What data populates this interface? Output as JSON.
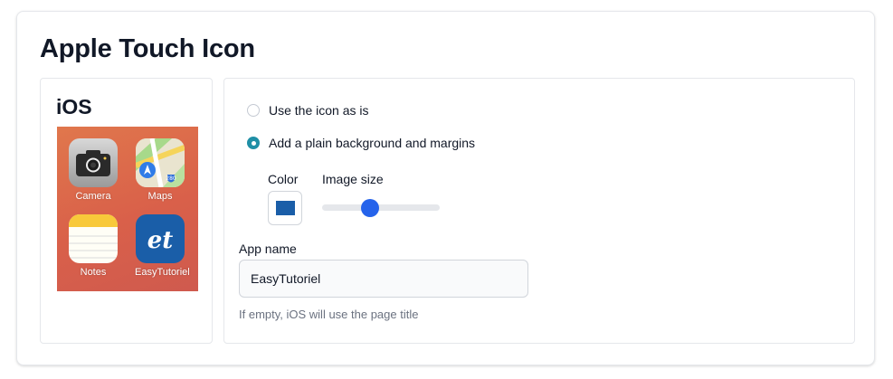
{
  "page": {
    "title": "Apple Touch Icon"
  },
  "preview": {
    "title": "iOS",
    "apps": [
      {
        "label": "Camera",
        "icon": "camera-icon"
      },
      {
        "label": "Maps",
        "icon": "maps-icon",
        "badge": "280"
      },
      {
        "label": "Notes",
        "icon": "notes-icon"
      },
      {
        "label": "EasyTutoriel",
        "icon": "easytutoriel-icon",
        "glyph": "et"
      }
    ]
  },
  "settings": {
    "options": [
      {
        "label": "Use the icon as is",
        "checked": false
      },
      {
        "label": "Add a plain background and margins",
        "checked": true
      }
    ],
    "color_label": "Color",
    "color_value": "#1a5ea8",
    "image_size_label": "Image size",
    "image_size_fraction": 0.41,
    "app_name_label": "App name",
    "app_name_value": "EasyTutoriel",
    "help_text": "If empty, iOS will use the page title"
  },
  "colors": {
    "accent_radio": "#1f8fa6",
    "slider_thumb": "#2563eb"
  }
}
